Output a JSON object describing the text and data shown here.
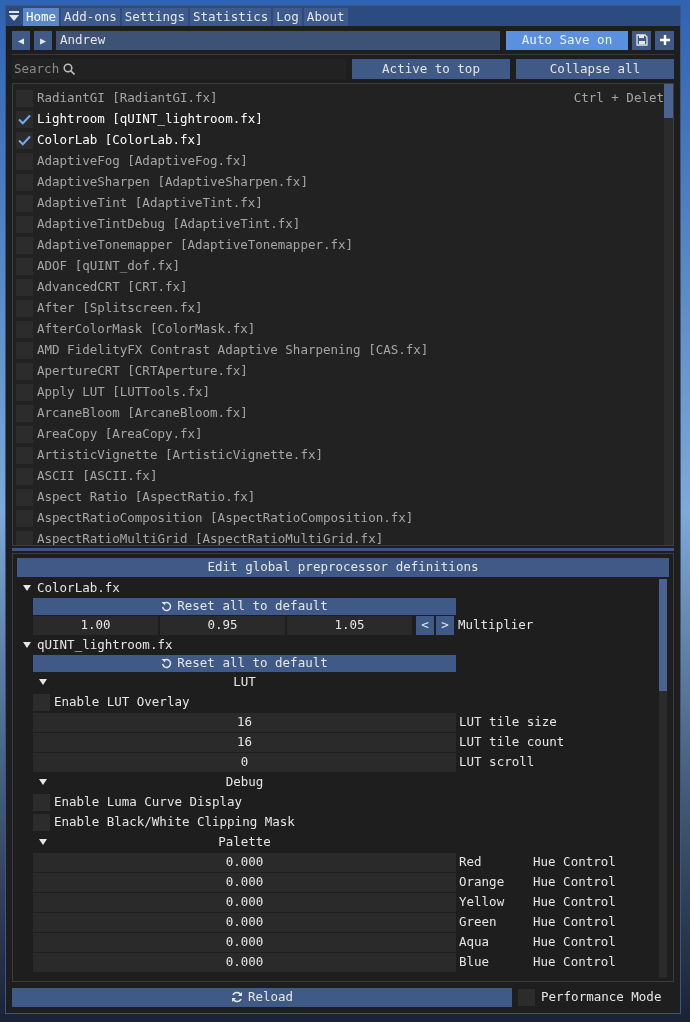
{
  "tabs": [
    {
      "label": "Home",
      "selected": true
    },
    {
      "label": "Add-ons",
      "selected": false
    },
    {
      "label": "Settings",
      "selected": false
    },
    {
      "label": "Statistics",
      "selected": false
    },
    {
      "label": "Log",
      "selected": false
    },
    {
      "label": "About",
      "selected": false
    }
  ],
  "preset": {
    "previous": "◀",
    "next": "▶",
    "name": "Andrew",
    "auto_save": {
      "label": "Auto Save on",
      "on": true
    }
  },
  "search": {
    "placeholder": "Search"
  },
  "list_buttons": [
    "Active to top",
    "Collapse all"
  ],
  "effects": [
    {
      "label": "RadiantGI [RadiantGI.fx]",
      "checked": false,
      "shortcut": "Ctrl + Delet"
    },
    {
      "label": "Lightroom [qUINT_lightroom.fx]",
      "checked": true
    },
    {
      "label": "ColorLab [ColorLab.fx]",
      "checked": true
    },
    {
      "label": "AdaptiveFog [AdaptiveFog.fx]",
      "checked": false
    },
    {
      "label": "AdaptiveSharpen [AdaptiveSharpen.fx]",
      "checked": false
    },
    {
      "label": "AdaptiveTint [AdaptiveTint.fx]",
      "checked": false
    },
    {
      "label": "AdaptiveTintDebug [AdaptiveTint.fx]",
      "checked": false
    },
    {
      "label": "AdaptiveTonemapper [AdaptiveTonemapper.fx]",
      "checked": false
    },
    {
      "label": "ADOF [qUINT_dof.fx]",
      "checked": false
    },
    {
      "label": "AdvancedCRT [CRT.fx]",
      "checked": false
    },
    {
      "label": "After [Splitscreen.fx]",
      "checked": false
    },
    {
      "label": "AfterColorMask [ColorMask.fx]",
      "checked": false
    },
    {
      "label": "AMD FidelityFX Contrast Adaptive Sharpening [CAS.fx]",
      "checked": false
    },
    {
      "label": "ApertureCRT [CRTAperture.fx]",
      "checked": false
    },
    {
      "label": "Apply LUT [LUTTools.fx]",
      "checked": false
    },
    {
      "label": "ArcaneBloom [ArcaneBloom.fx]",
      "checked": false
    },
    {
      "label": "AreaCopy [AreaCopy.fx]",
      "checked": false
    },
    {
      "label": "ArtisticVignette [ArtisticVignette.fx]",
      "checked": false
    },
    {
      "label": "ASCII [ASCII.fx]",
      "checked": false
    },
    {
      "label": "Aspect Ratio [AspectRatio.fx]",
      "checked": false
    },
    {
      "label": "AspectRatioComposition [AspectRatioComposition.fx]",
      "checked": false
    },
    {
      "label": "AspectRatioMultiGrid [AspectRatioMultiGrid.fx]",
      "checked": false
    }
  ],
  "definitions_button": "Edit global preprocessor definitions",
  "effect_settings": [
    {
      "title": "ColorLab.fx",
      "expanded": true,
      "reset": "Reset all to default",
      "items": [
        {
          "kind": "float3",
          "values": [
            "1.00",
            "0.95",
            "1.05"
          ],
          "decrement": "<",
          "increment": ">",
          "label": "Multiplier"
        }
      ]
    },
    {
      "title": "qUINT_lightroom.fx",
      "expanded": true,
      "reset": "Reset all to default",
      "items": [
        {
          "kind": "category",
          "title": "LUT",
          "expanded": true,
          "children": [
            {
              "kind": "checkbox",
              "label": "Enable LUT Overlay",
              "checked": false
            },
            {
              "kind": "slider",
              "value": "16",
              "label": "LUT tile size"
            },
            {
              "kind": "slider",
              "value": "16",
              "label": "LUT tile count"
            },
            {
              "kind": "slider",
              "value": "0",
              "label": "LUT scroll"
            }
          ]
        },
        {
          "kind": "category",
          "title": "Debug",
          "expanded": true,
          "children": [
            {
              "kind": "checkbox",
              "label": "Enable Luma Curve Display",
              "checked": false
            },
            {
              "kind": "checkbox",
              "label": "Enable Black/White Clipping Mask",
              "checked": false
            }
          ]
        },
        {
          "kind": "category",
          "title": "Palette",
          "expanded": true,
          "children": [
            {
              "kind": "slider",
              "value": "0.000",
              "label": "Red",
              "note": "Hue Control"
            },
            {
              "kind": "slider",
              "value": "0.000",
              "label": "Orange",
              "note": "Hue Control"
            },
            {
              "kind": "slider",
              "value": "0.000",
              "label": "Yellow",
              "note": "Hue Control"
            },
            {
              "kind": "slider",
              "value": "0.000",
              "label": "Green",
              "note": "Hue Control"
            },
            {
              "kind": "slider",
              "value": "0.000",
              "label": "Aqua",
              "note": "Hue Control"
            },
            {
              "kind": "slider",
              "value": "0.000",
              "label": "Blue",
              "note": "Hue Control"
            }
          ]
        }
      ]
    }
  ],
  "reload": "Reload",
  "performance_mode": {
    "label": "Performance Mode",
    "checked": false
  }
}
